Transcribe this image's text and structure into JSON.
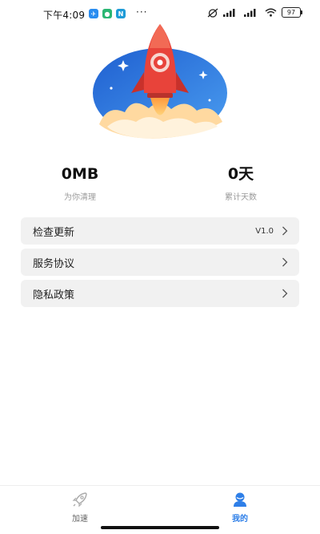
{
  "status_bar": {
    "time": "下午4:09",
    "more": "···",
    "battery": "97"
  },
  "stats": {
    "cleaned_value": "0MB",
    "cleaned_label": "为你清理",
    "days_value": "0天",
    "days_label": "累计天数"
  },
  "menu": [
    {
      "label": "检查更新",
      "value": "V1.0"
    },
    {
      "label": "服务协议",
      "value": ""
    },
    {
      "label": "隐私政策",
      "value": ""
    }
  ],
  "tabs": [
    {
      "label": "加速",
      "active": false
    },
    {
      "label": "我的",
      "active": true
    }
  ],
  "colors": {
    "accent": "#2e7fe8",
    "rocket_red": "#e8433a",
    "sky_blue": "#2f74d8",
    "menu_bg": "#f1f1f1"
  }
}
